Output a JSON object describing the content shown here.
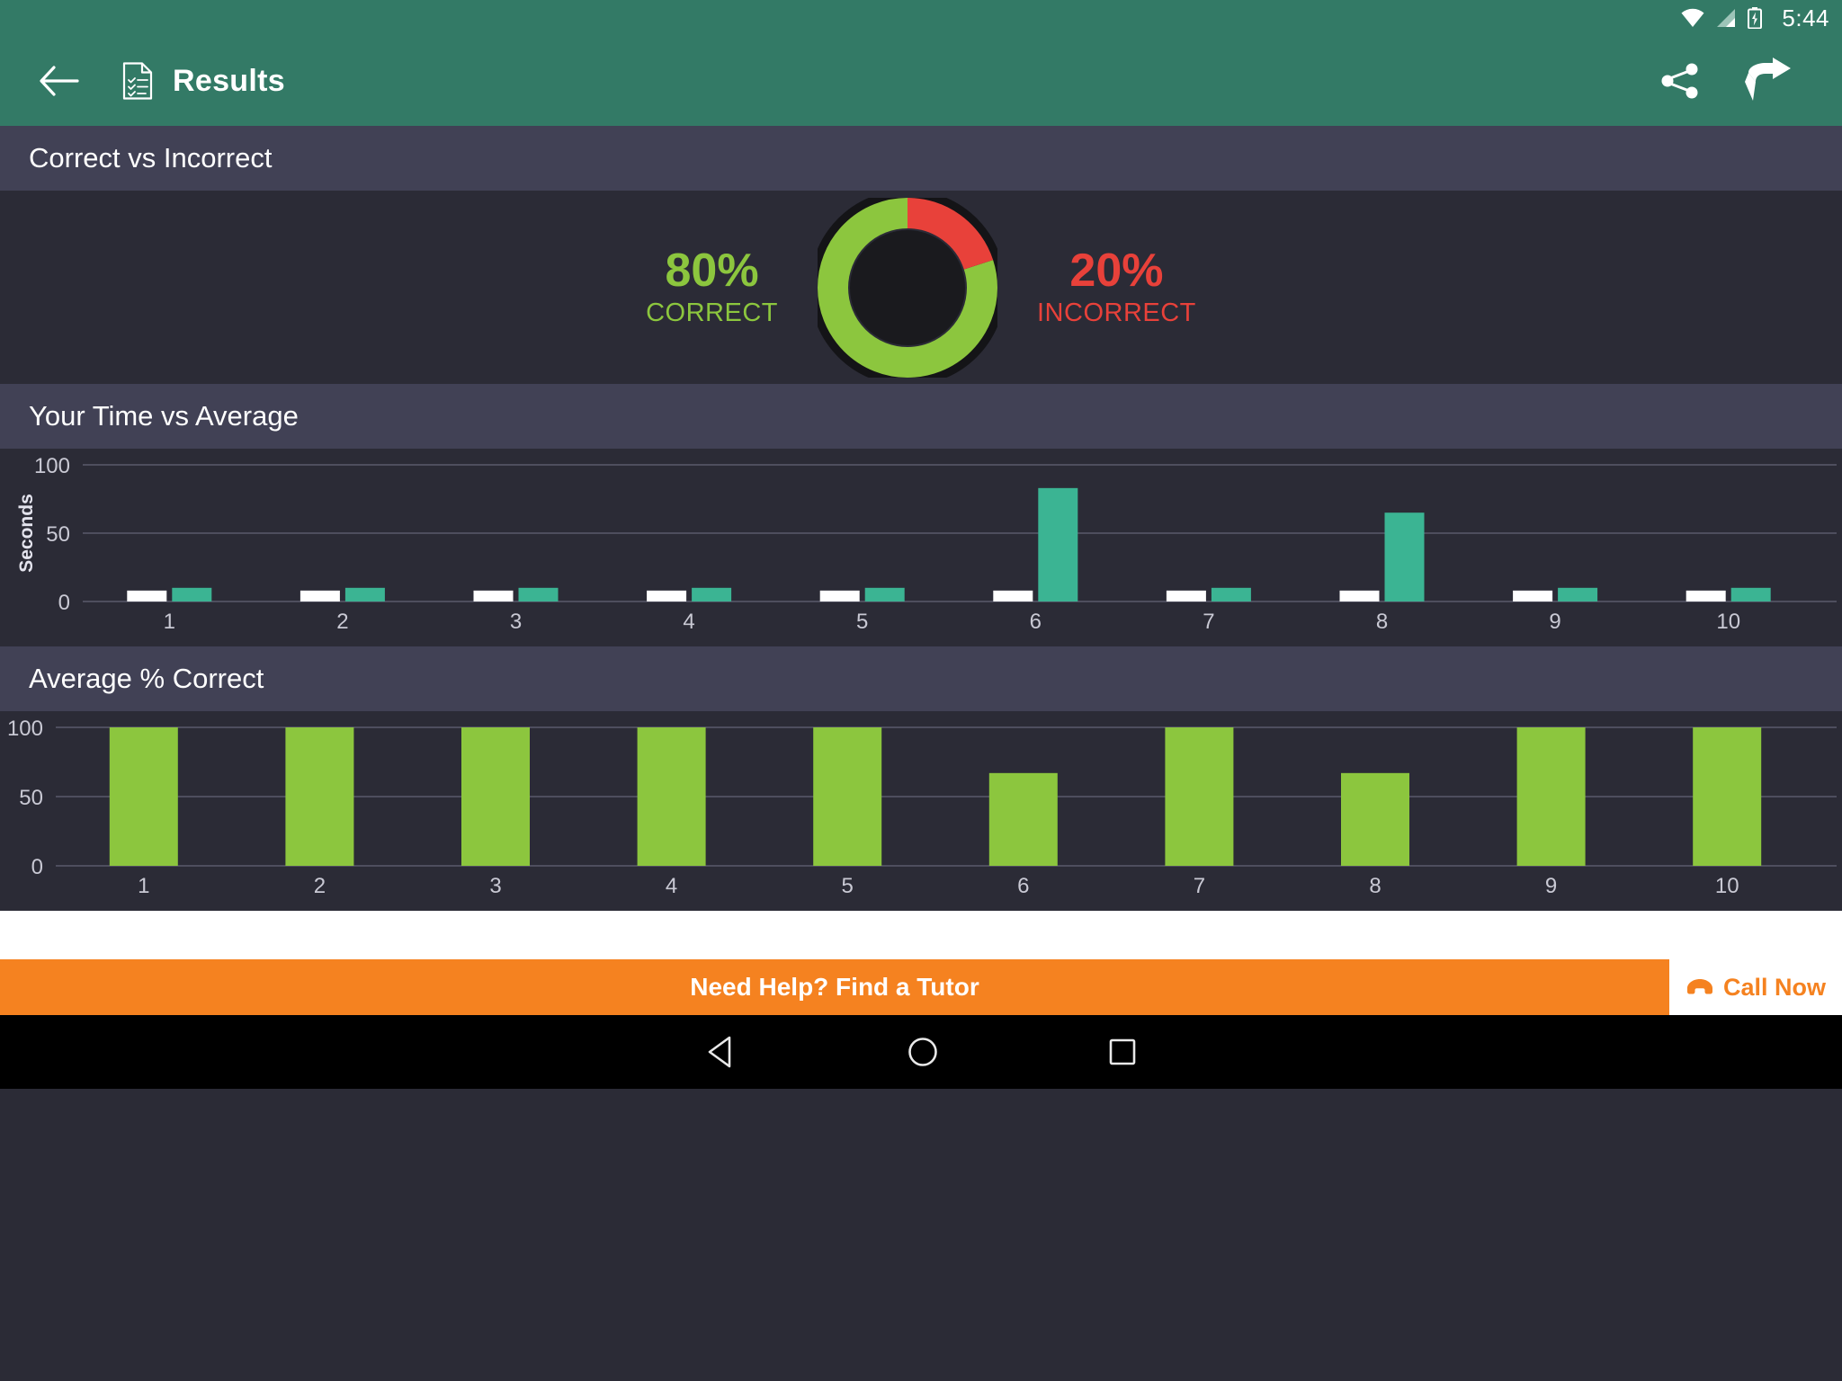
{
  "statusbar": {
    "time": "5:44",
    "icons": [
      "wifi-icon",
      "signal-icon",
      "battery-charging-icon"
    ]
  },
  "appbar": {
    "back_icon": "back-arrow-icon",
    "doc_icon": "document-checklist-icon",
    "title": "Results",
    "share_icon": "share-icon",
    "next_icon": "next-arrow-icon"
  },
  "sections": {
    "correct_vs_incorrect": {
      "title": "Correct vs Incorrect",
      "correct_pct": "80%",
      "correct_label": "CORRECT",
      "incorrect_pct": "20%",
      "incorrect_label": "INCORRECT",
      "correct_color": "#8cc63e",
      "incorrect_color": "#e8413a"
    },
    "time_vs_average": {
      "title": "Your Time vs Average"
    },
    "average_correct": {
      "title": "Average % Correct"
    }
  },
  "banner": {
    "text": "Need Help? Find a Tutor",
    "cta_label": "Call Now",
    "phone_icon": "phone-icon",
    "banner_color": "#f58220"
  },
  "navbar": {
    "back": "nav-back-triangle-icon",
    "home": "nav-home-circle-icon",
    "recent": "nav-recent-square-icon"
  },
  "chart_data": [
    {
      "type": "bar",
      "title": "Your Time vs Average",
      "xlabel": "",
      "ylabel": "Seconds",
      "categories": [
        "1",
        "2",
        "3",
        "4",
        "5",
        "6",
        "7",
        "8",
        "9",
        "10"
      ],
      "yticks": [
        "0",
        "50",
        "100"
      ],
      "ylim": [
        0,
        100
      ],
      "grid": true,
      "legend": "none",
      "series": [
        {
          "name": "Your Time",
          "color": "#ffffff",
          "values": [
            8,
            8,
            8,
            8,
            8,
            8,
            8,
            8,
            8,
            8
          ]
        },
        {
          "name": "Average",
          "color": "#3bb493",
          "values": [
            10,
            10,
            10,
            10,
            10,
            83,
            10,
            65,
            10,
            10
          ]
        }
      ]
    },
    {
      "type": "bar",
      "title": "Average % Correct",
      "xlabel": "",
      "ylabel": "",
      "categories": [
        "1",
        "2",
        "3",
        "4",
        "5",
        "6",
        "7",
        "8",
        "9",
        "10"
      ],
      "yticks": [
        "0",
        "50",
        "100"
      ],
      "ylim": [
        0,
        100
      ],
      "grid": true,
      "legend": "none",
      "series": [
        {
          "name": "Average % Correct",
          "color": "#8cc63e",
          "values": [
            100,
            100,
            100,
            100,
            100,
            67,
            100,
            67,
            100,
            100
          ]
        }
      ]
    }
  ],
  "donut_data": {
    "type": "pie",
    "title": "Correct vs Incorrect",
    "labels": [
      "Correct",
      "Incorrect"
    ],
    "values": [
      80,
      20
    ],
    "colors": [
      "#8cc63e",
      "#e8413a"
    ]
  }
}
